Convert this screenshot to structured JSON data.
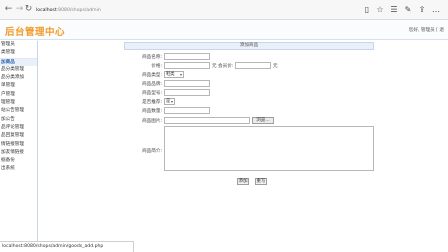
{
  "browser": {
    "back_icon": "back-arrow-icon",
    "forward_icon": "forward-arrow-icon",
    "reload_icon": "reload-icon",
    "address_host": "localhost",
    "address_path": ":8080/shops/admin",
    "tool_icons": [
      "reading-view-icon",
      "favorite-star-icon",
      "favorites-list-icon",
      "pen-icon",
      "share-icon",
      "more-icon"
    ]
  },
  "app": {
    "title": "后台管理中心",
    "user_info": "您好, 管理员 [ 退"
  },
  "sidebar": {
    "items": [
      {
        "label": "管理员",
        "active": false
      },
      {
        "label": "类管理",
        "active": false
      },
      {
        "label": "加商品",
        "active": true
      },
      {
        "label": "品分类管理",
        "active": false
      },
      {
        "label": "品分类添加",
        "active": false
      },
      {
        "label": "单管理",
        "active": false
      },
      {
        "label": "户管理",
        "active": false
      },
      {
        "label": "理管理",
        "active": false
      },
      {
        "label": "站公告管理",
        "active": false
      },
      {
        "label": "加公告",
        "active": false
      },
      {
        "label": "品评论管理",
        "active": false
      },
      {
        "label": "品回复管理",
        "active": false
      },
      {
        "label": "情链接管理",
        "active": false
      },
      {
        "label": "加友情链接",
        "active": false
      },
      {
        "label": "据备份",
        "active": false
      },
      {
        "label": "出系统",
        "active": false
      }
    ]
  },
  "form": {
    "panel_title": "添加商品",
    "labels": {
      "name": "商品名称:",
      "price": "价格:",
      "member_price": "会员价:",
      "category": "商品类型:",
      "brand": "商品品牌:",
      "model": "商品型号:",
      "recommend": "是否推荐:",
      "quantity": "商品数量:",
      "image": "商品图片:",
      "description": "商品简介:"
    },
    "price_unit": "元",
    "member_price_unit": "元",
    "category_value": "鞋类",
    "recommend_value": "是",
    "browse_label": "浏览...",
    "submit_label": "添加",
    "reset_label": "重写"
  },
  "status_bar": {
    "text": "localhost:8080/shops/admin/goods_add.php"
  }
}
